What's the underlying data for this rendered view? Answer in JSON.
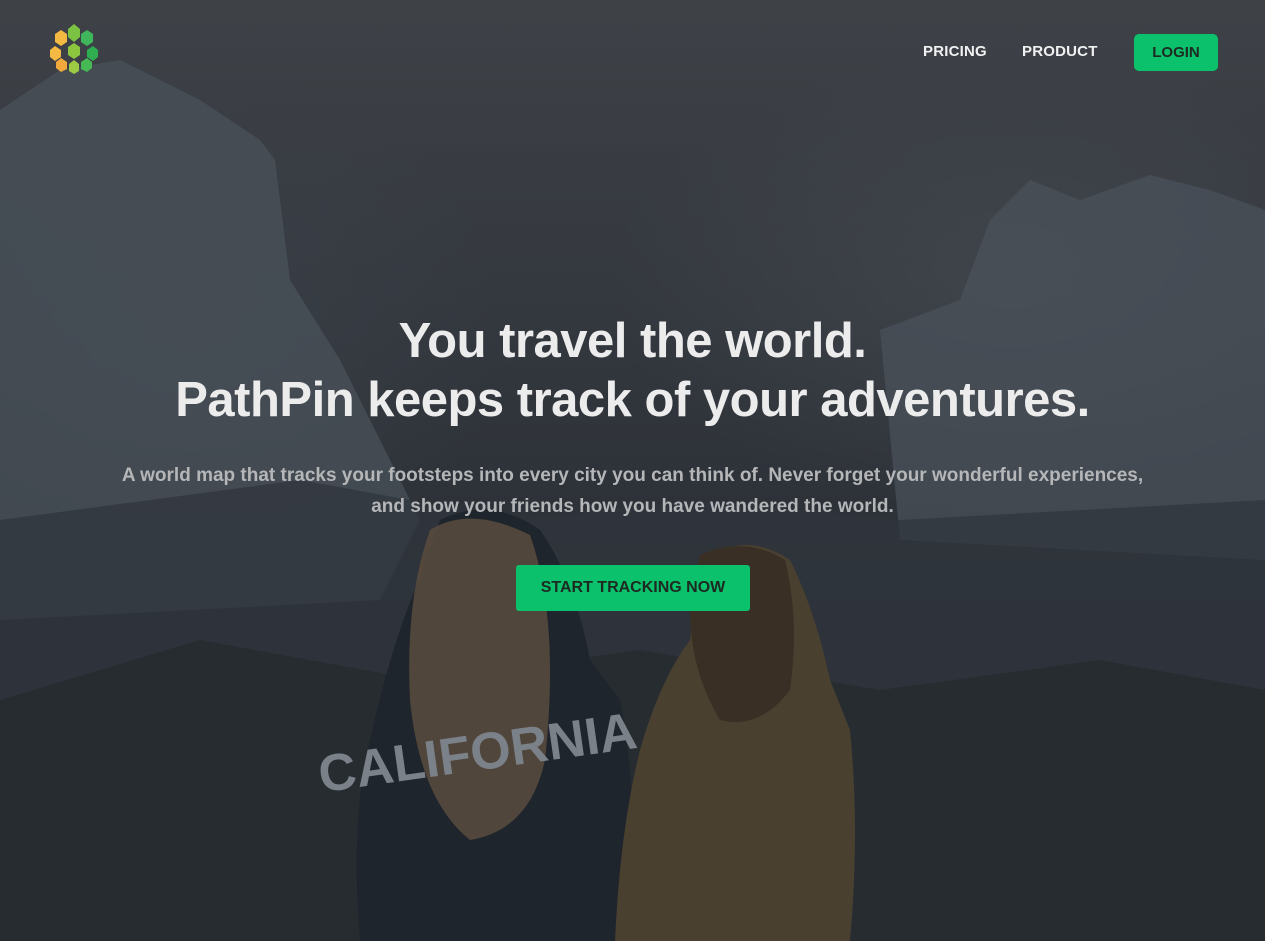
{
  "nav": {
    "logo": "pathpin-logo",
    "links": [
      {
        "label": "PRICING"
      },
      {
        "label": "PRODUCT"
      }
    ],
    "login_label": "LOGIN"
  },
  "hero": {
    "title_line1": "You travel the world.",
    "title_line2": "PathPin keeps track of your adventures.",
    "subtitle_line1": "A world map that tracks your footsteps into every city you can think of. Never forget your wonderful experiences,",
    "subtitle_line2": "and show your friends how you have wandered the world.",
    "cta_label": "START TRACKING NOW"
  },
  "background": {
    "sweatshirt_text": "CALIFORNIA"
  },
  "colors": {
    "accent": "#0bc16b",
    "text": "#ececec",
    "muted": "#b5b6b8"
  }
}
